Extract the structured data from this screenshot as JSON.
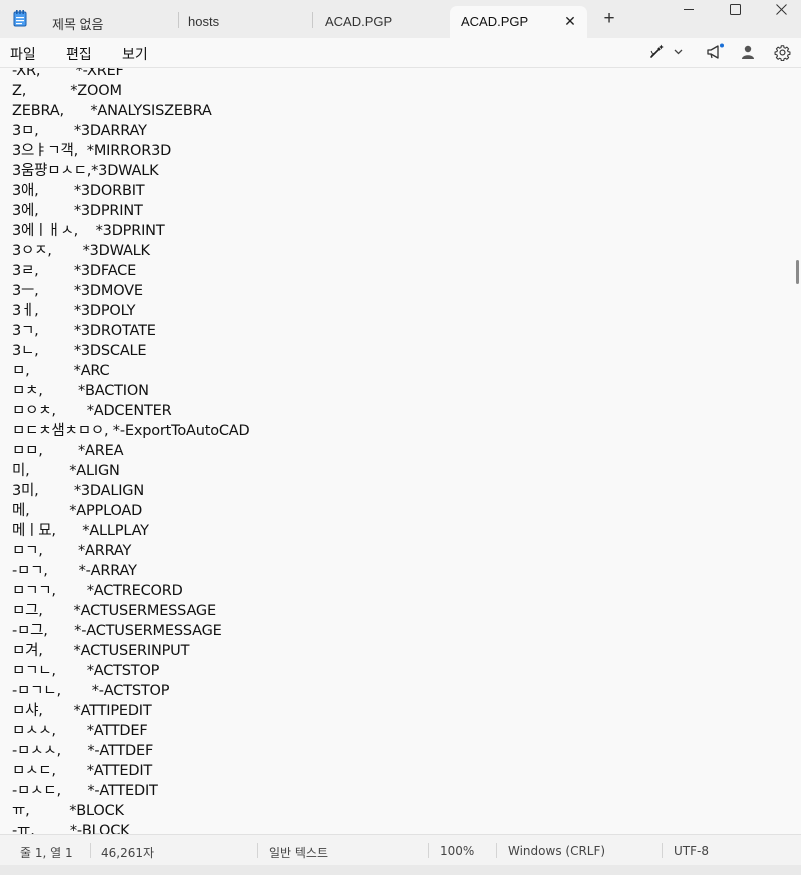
{
  "tabs": [
    {
      "label": "제목 없음"
    },
    {
      "label": "hosts"
    },
    {
      "label": "ACAD.PGP"
    },
    {
      "label": "ACAD.PGP",
      "active": true
    }
  ],
  "new_tab_label": "+",
  "window_controls": {
    "minimize": "─",
    "maximize": "☐",
    "close": "✕"
  },
  "menu": {
    "file": "파일",
    "edit": "편집",
    "view": "보기"
  },
  "toolbar_icons": [
    "copilot-rewrite-icon",
    "megaphone-icon",
    "account-icon",
    "settings-gear-icon"
  ],
  "lines": [
    "-XR,        *-XREF",
    "Z,          *ZOOM",
    "ZEBRA,      *ANALYSISZEBRA",
    "3ㅁ,        *3DARRAY",
    "3으ㅑㄱ객,  *MIRROR3D",
    "3움퍙ㅁㅅㄷ,*3DWALK",
    "3애,        *3DORBIT",
    "3에,        *3DPRINT",
    "3에ㅣㅐㅅ,    *3DPRINT",
    "3ㅇㅈ,       *3DWALK",
    "3ㄹ,        *3DFACE",
    "3ㅡ,        *3DMOVE",
    "3ㅔ,        *3DPOLY",
    "3ㄱ,        *3DROTATE",
    "3ㄴ,        *3DSCALE",
    "ㅁ,          *ARC",
    "ㅁㅊ,        *BACTION",
    "ㅁㅇㅊ,       *ADCENTER",
    "ㅁㄷㅊ샘ㅊㅁㅇ, *-ExportToAutoCAD",
    "ㅁㅁ,        *AREA",
    "미,         *ALIGN",
    "3미,        *3DALIGN",
    "메,         *APPLOAD",
    "메ㅣ묘,      *ALLPLAY",
    "ㅁㄱ,        *ARRAY",
    "-ㅁㄱ,       *-ARRAY",
    "ㅁㄱㄱ,       *ACTRECORD",
    "ㅁ그,       *ACTUSERMESSAGE",
    "-ㅁ그,      *-ACTUSERMESSAGE",
    "ㅁ겨,       *ACTUSERINPUT",
    "ㅁㄱㄴ,       *ACTSTOP",
    "-ㅁㄱㄴ,       *-ACTSTOP",
    "ㅁ샤,       *ATTIPEDIT",
    "ㅁㅅㅅ,       *ATTDEF",
    "-ㅁㅅㅅ,      *-ATTDEF",
    "ㅁㅅㄷ,       *ATTEDIT",
    "-ㅁㅅㄷ,      *-ATTEDIT",
    "ㅠ,         *BLOCK",
    "-ㅠ,        *-BLOCK"
  ],
  "status": {
    "position": "줄 1, 열 1",
    "char_count": "46,261자",
    "format": "일반 텍스트",
    "zoom": "100%",
    "line_ending": "Windows (CRLF)",
    "encoding": "UTF-8"
  }
}
